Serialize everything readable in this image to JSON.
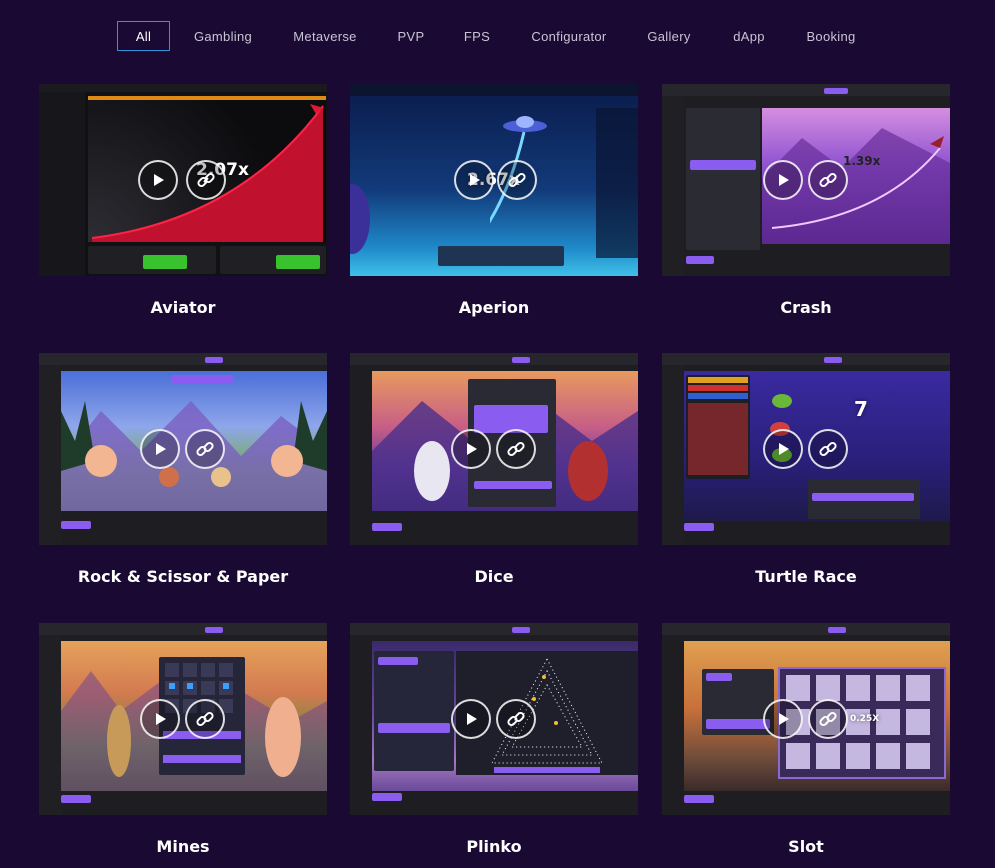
{
  "filters": [
    {
      "label": "All",
      "active": true
    },
    {
      "label": "Gambling"
    },
    {
      "label": "Metaverse"
    },
    {
      "label": "PVP"
    },
    {
      "label": "FPS"
    },
    {
      "label": "Configurator"
    },
    {
      "label": "Gallery"
    },
    {
      "label": "dApp"
    },
    {
      "label": "Booking"
    }
  ],
  "games": [
    {
      "title": "Aviator",
      "multiplier": "2.07x"
    },
    {
      "title": "Aperion",
      "multiplier": "2.67x"
    },
    {
      "title": "Crash",
      "multiplier": "1.39x"
    },
    {
      "title": "Rock & Scissor & Paper"
    },
    {
      "title": "Dice"
    },
    {
      "title": "Turtle Race",
      "counter": "7"
    },
    {
      "title": "Mines"
    },
    {
      "title": "Plinko"
    },
    {
      "title": "Slot",
      "multiplier": "0.25X"
    }
  ],
  "icons": {
    "play": "play-icon",
    "link": "link-icon"
  },
  "colors": {
    "background": "#1a0a33",
    "active_tab_border": "#3a8fd6",
    "accent_purple": "#8a5cf0",
    "bet_green": "#37c22e"
  }
}
